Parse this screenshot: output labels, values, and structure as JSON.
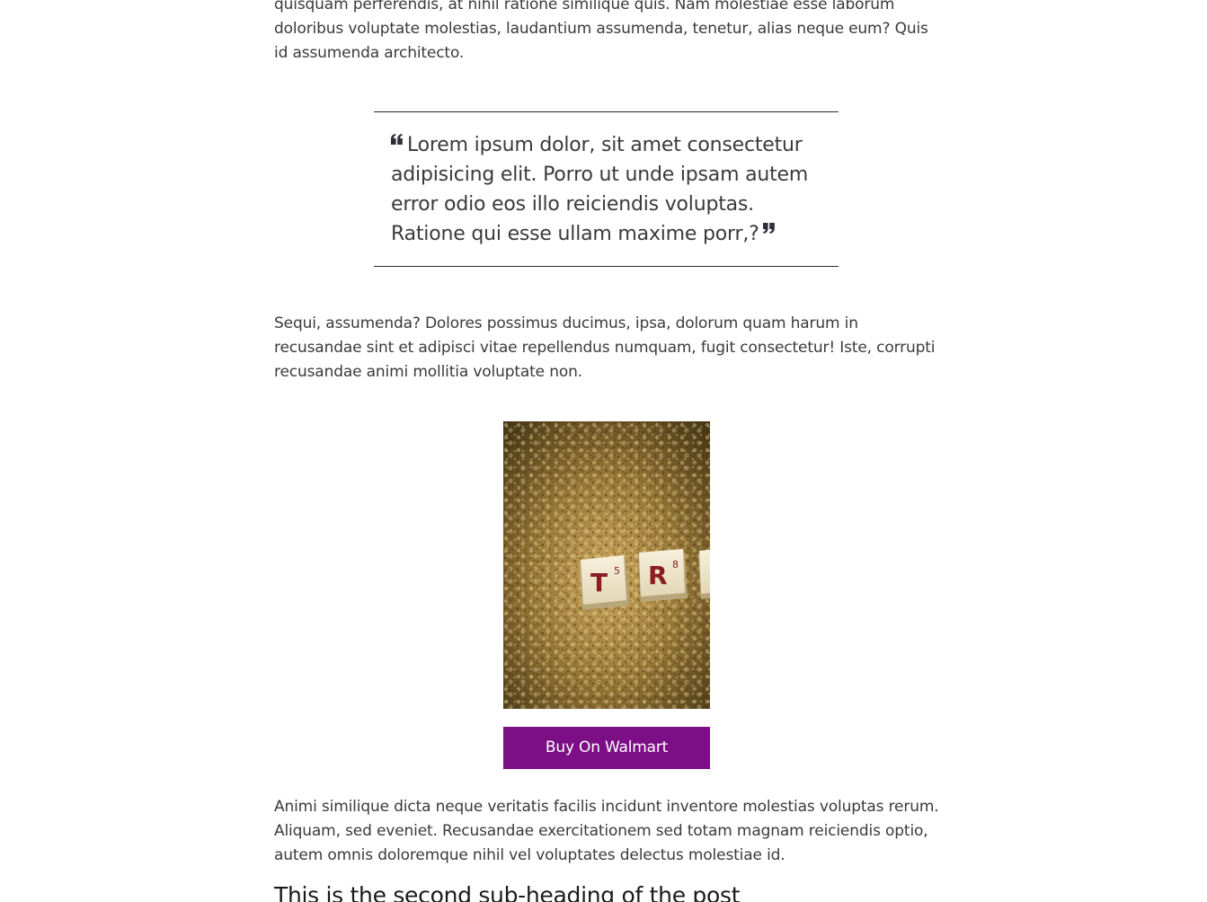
{
  "article": {
    "paragraph_top": "quisquam perferendis, at nihil ratione similique quis. Nam molestiae esse laborum doloribus voluptate molestias, laudantium assumenda, tenetur, alias neque eum? Quis id assumenda architecto.",
    "blockquote": "Lorem ipsum dolor, sit amet consectetur adipisicing elit. Porro ut unde ipsam autem error odio eos illo reiciendis voluptas. Ratione qui esse ullam maxime porr,?",
    "paragraph_2": "Sequi, assumenda? Dolores possimus ducimus, ipsa, dolorum quam harum in recusandae sint et adipisci vitae repellendus numquam, fugit consectetur! Iste, corrupti recusandae animi mollitia voluptate non.",
    "product": {
      "tiles": [
        {
          "letter": "T",
          "points": "5"
        },
        {
          "letter": "R",
          "points": "8"
        }
      ],
      "button_label": "Buy On Walmart"
    },
    "paragraph_3": "Animi similique dicta neque veritatis facilis incidunt inventore molestias voluptas rerum. Aliquam, sed eveniet. Recusandae exercitationem sed totam magnam reiciendis optio, autem omnis doloremque nihil vel voluptates delectus molestiae id.",
    "subheading": "This is the second sub-heading of the post"
  },
  "colors": {
    "button_bg": "#7d0f86",
    "button_text": "#ffffff",
    "body_text": "#3a3a3a",
    "rule": "#2a2a2a"
  },
  "icons": {
    "open_quote": "quote-left-icon",
    "close_quote": "quote-right-icon"
  }
}
